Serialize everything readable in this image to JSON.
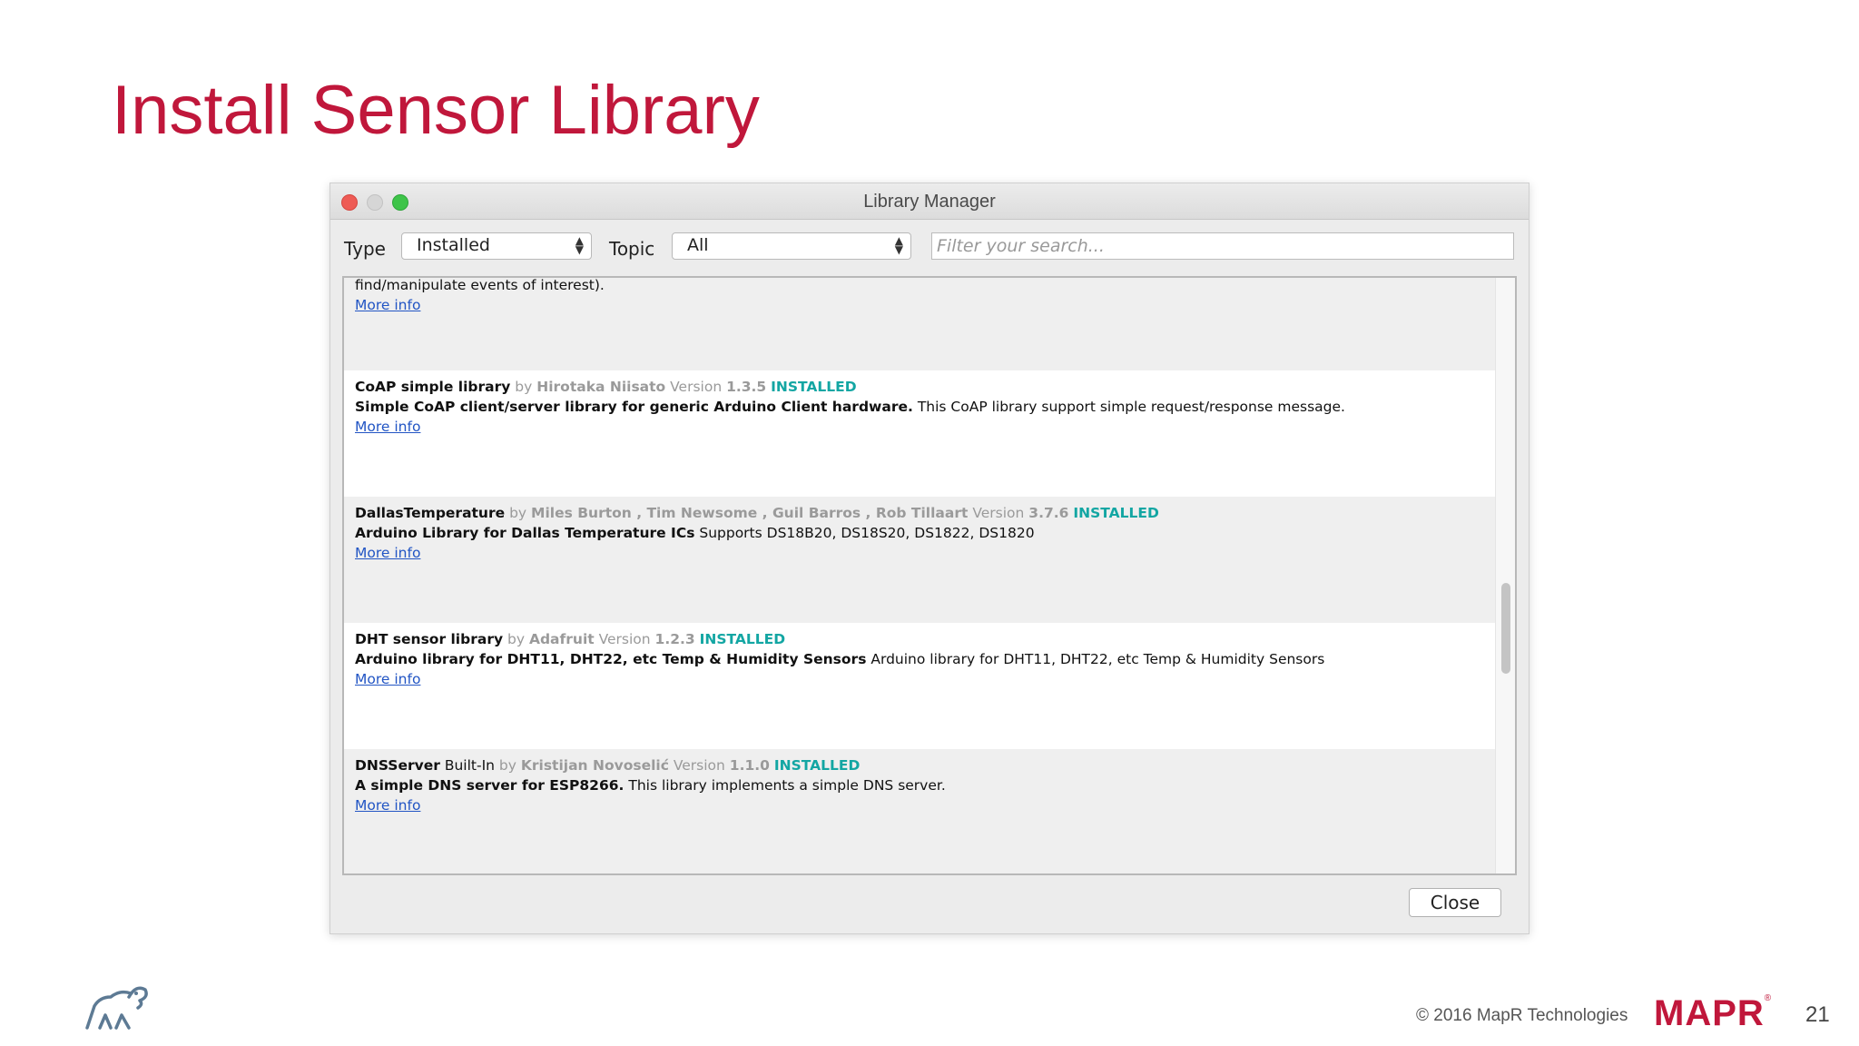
{
  "slide": {
    "title": "Install Sensor Library",
    "copyright": "© 2016 MapR Technologies",
    "brand": "MAPR",
    "page_number": "21"
  },
  "window": {
    "title": "Library Manager"
  },
  "filters": {
    "type_label": "Type",
    "type_value": "Installed",
    "topic_label": "Topic",
    "topic_value": "All",
    "search_placeholder": "Filter your search..."
  },
  "entries": [
    {
      "desc_plain": "find/manipulate events of interest).",
      "more": "More info"
    },
    {
      "name": "CoAP simple library",
      "by": "by",
      "authors": "Hirotaka Niisato",
      "version_label": "Version",
      "version": "1.3.5",
      "status": "INSTALLED",
      "desc_bold": "Simple CoAP client/server library for generic Arduino Client hardware.",
      "desc_plain": "This CoAP library support simple request/response message.",
      "more": "More info"
    },
    {
      "name": "DallasTemperature",
      "by": "by",
      "authors": "Miles Burton , Tim Newsome , Guil Barros , Rob Tillaart",
      "version_label": "Version",
      "version": "3.7.6",
      "status": "INSTALLED",
      "desc_bold": "Arduino Library for Dallas Temperature ICs",
      "desc_plain": "Supports DS18B20, DS18S20, DS1822, DS1820",
      "more": "More info"
    },
    {
      "name": "DHT sensor library",
      "by": "by",
      "authors": "Adafruit",
      "version_label": "Version",
      "version": "1.2.3",
      "status": "INSTALLED",
      "desc_bold": "Arduino library for DHT11, DHT22, etc Temp & Humidity Sensors",
      "desc_plain": "Arduino library for DHT11, DHT22, etc Temp & Humidity Sensors",
      "more": "More info"
    },
    {
      "name": "DNSServer",
      "builtin": "Built-In",
      "by": "by",
      "authors": "Kristijan Novoselić",
      "version_label": "Version",
      "version": "1.1.0",
      "status": "INSTALLED",
      "desc_bold": "A simple DNS server for ESP8266.",
      "desc_plain": "This library implements a simple DNS server.",
      "more": "More info"
    }
  ],
  "buttons": {
    "close": "Close"
  },
  "colors": {
    "title": "#c0173b",
    "installed": "#13a6a3",
    "link": "#2255c4"
  }
}
